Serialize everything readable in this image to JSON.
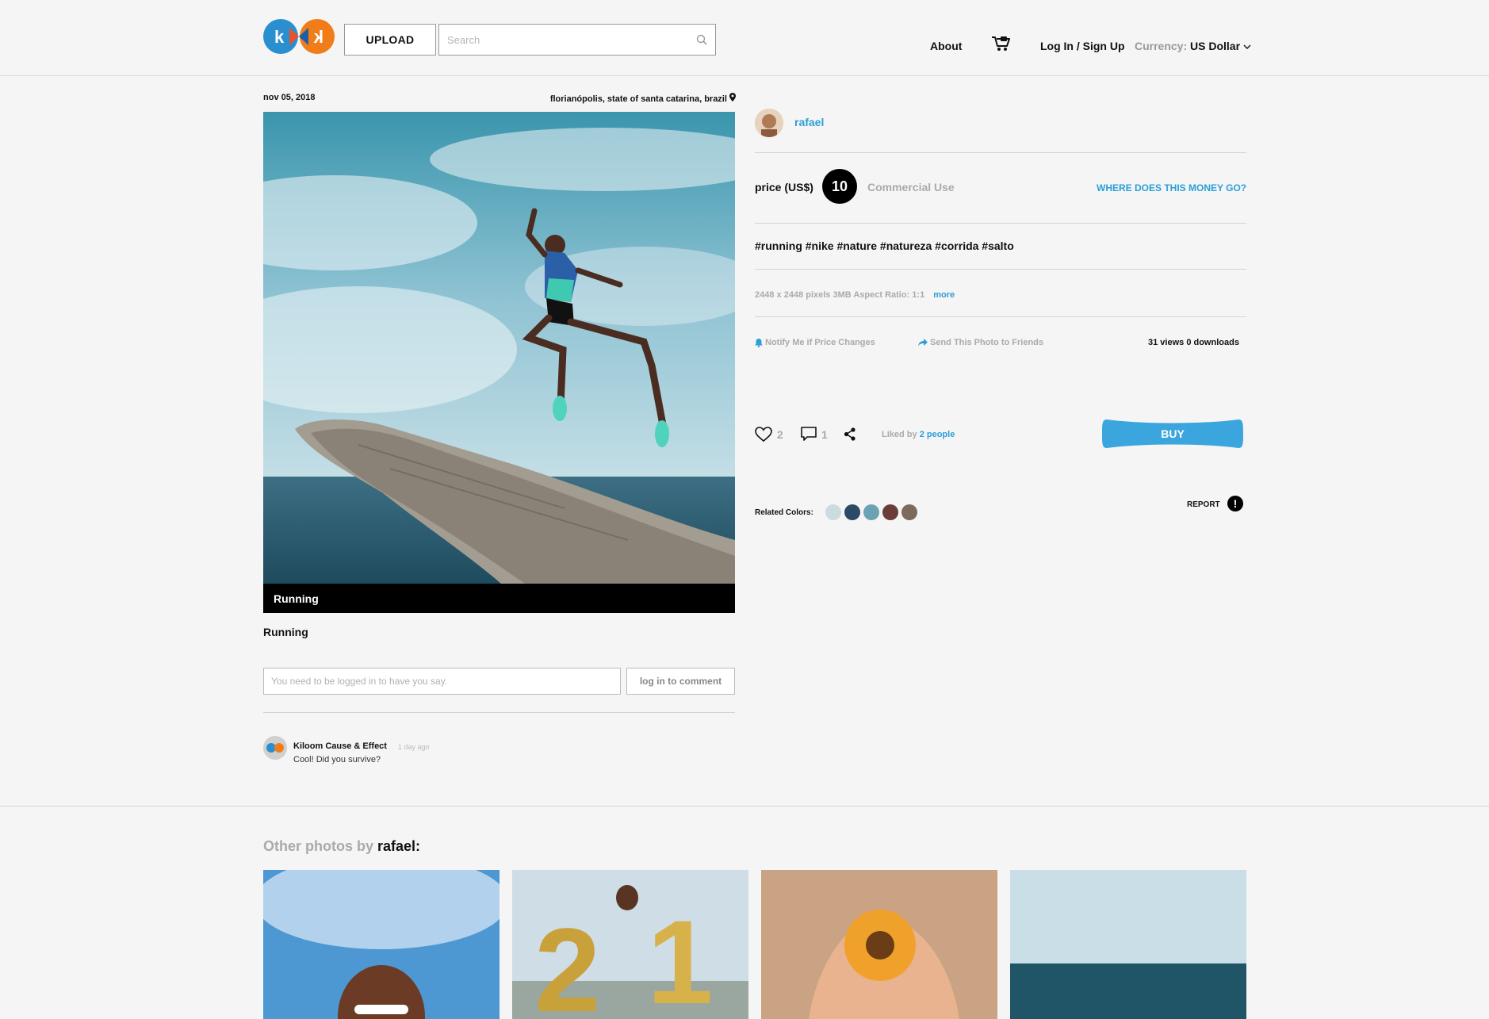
{
  "header": {
    "upload_label": "UPLOAD",
    "search_placeholder": "Search",
    "about": "About",
    "login": "Log In / Sign Up",
    "currency_label": "Currency:",
    "currency_value": "US Dollar",
    "logo_left": "k",
    "logo_right": "k"
  },
  "photo": {
    "date": "nov 05, 2018",
    "location": "florianópolis, state of santa catarina, brazil",
    "caption": "Running",
    "title": "Running"
  },
  "comments": {
    "input_placeholder": "You need to be logged in to have you say.",
    "login_button": "log in to comment",
    "items": [
      {
        "author": "Kiloom Cause & Effect",
        "time": "1 day ago",
        "text": "Cool! Did you survive?"
      }
    ]
  },
  "author": {
    "name": "rafael"
  },
  "pricing": {
    "label": "price (US$)",
    "value": "10",
    "license": "Commercial Use",
    "money_link": "WHERE DOES THIS MONEY GO?"
  },
  "tags": "#running #nike #nature #natureza #corrida #salto",
  "meta": {
    "info": "2448 x 2448 pixels 3MB Aspect Ratio: 1:1",
    "more": "more"
  },
  "actions": {
    "notify": "Notify Me if Price Changes",
    "send": "Send This Photo to Friends",
    "stats": "31 views 0 downloads",
    "likes": "2",
    "comments": "1",
    "liked_by_prefix": "Liked by",
    "liked_by_link": "2 people",
    "buy": "BUY",
    "report": "REPORT",
    "report_icon": "!"
  },
  "related_colors": {
    "label": "Related Colors:",
    "colors": [
      "#c9dde0",
      "#2b4a66",
      "#6ba3b4",
      "#6b3d3a",
      "#7d6a5c"
    ]
  },
  "other_photos": {
    "prefix": "Other photos by",
    "user": "rafael:"
  },
  "colors": {
    "accent": "#2a9fd8",
    "buy": "#3ba6de"
  }
}
